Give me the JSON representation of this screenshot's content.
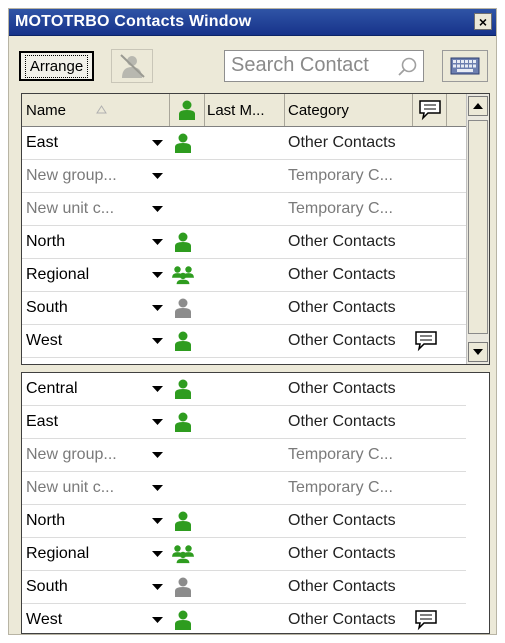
{
  "window": {
    "title": "MOTOTRBO Contacts Window",
    "close_label": "×"
  },
  "toolbar": {
    "arrange_label": "Arrange",
    "search_placeholder": "Search Contact",
    "icons": [
      "user-disabled-icon",
      "search-icon",
      "keyboard-icon"
    ]
  },
  "columns": {
    "name": "Name",
    "last_m": "Last M...",
    "category": "Category"
  },
  "colors": {
    "title_bar": "#1f3f96",
    "online_green": "#2e9c1f",
    "offline_gray": "#8c8c8c"
  },
  "top_list": [
    {
      "name": "East",
      "icon": "user-online-icon",
      "category": "Other Contacts",
      "msg": false
    },
    {
      "name": "New group...",
      "icon": "",
      "category": "Temporary C...",
      "msg": false
    },
    {
      "name": "New unit c...",
      "icon": "",
      "category": "Temporary C...",
      "msg": false
    },
    {
      "name": "North",
      "icon": "user-online-icon",
      "category": "Other Contacts",
      "msg": false
    },
    {
      "name": "Regional",
      "icon": "group-online-icon",
      "category": "Other Contacts",
      "msg": false
    },
    {
      "name": "South",
      "icon": "user-offline-icon",
      "category": "Other Contacts",
      "msg": false
    },
    {
      "name": "West",
      "icon": "user-online-icon",
      "category": "Other Contacts",
      "msg": true
    }
  ],
  "bottom_list": [
    {
      "name": "Central",
      "icon": "user-online-icon",
      "category": "Other Contacts",
      "msg": false
    },
    {
      "name": "East",
      "icon": "user-online-icon",
      "category": "Other Contacts",
      "msg": false
    },
    {
      "name": "New group...",
      "icon": "",
      "category": "Temporary C...",
      "msg": false
    },
    {
      "name": "New unit c...",
      "icon": "",
      "category": "Temporary C...",
      "msg": false
    },
    {
      "name": "North",
      "icon": "user-online-icon",
      "category": "Other Contacts",
      "msg": false
    },
    {
      "name": "Regional",
      "icon": "group-online-icon",
      "category": "Other Contacts",
      "msg": false
    },
    {
      "name": "South",
      "icon": "user-offline-icon",
      "category": "Other Contacts",
      "msg": false
    },
    {
      "name": "West",
      "icon": "user-online-icon",
      "category": "Other Contacts",
      "msg": true
    }
  ]
}
